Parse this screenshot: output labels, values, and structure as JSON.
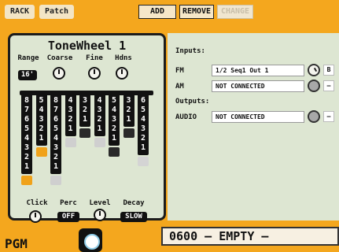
{
  "topbar": {
    "tabs": [
      "RACK",
      "Patch"
    ],
    "buttons": {
      "add": "ADD",
      "remove": "REMOVE",
      "change": "CHANGE"
    }
  },
  "synth": {
    "title": "ToneWheel 1",
    "controls": {
      "range": "Range",
      "coarse": "Coarse",
      "fine": "Fine",
      "hdns": "Hdns",
      "range_value": "16'"
    },
    "drawbars": [
      {
        "nums": [
          "8",
          "7",
          "6",
          "5",
          "4",
          "3",
          "2",
          "1"
        ],
        "color": "#f0a21a"
      },
      {
        "nums": [
          "5",
          "4",
          "3",
          "2",
          "1"
        ],
        "color": "#f0a21a"
      },
      {
        "nums": [
          "8",
          "7",
          "6",
          "5",
          "4",
          "3",
          "2",
          "1"
        ],
        "color": "#cfcfcf"
      },
      {
        "nums": [
          "4",
          "3",
          "2",
          "1"
        ],
        "color": "#cfcfcf"
      },
      {
        "nums": [
          "3",
          "2",
          "1"
        ],
        "color": "#2a2a2a"
      },
      {
        "nums": [
          "4",
          "3",
          "2",
          "1"
        ],
        "color": "#cfcfcf"
      },
      {
        "nums": [
          "5",
          "4",
          "3",
          "2",
          "1"
        ],
        "color": "#2a2a2a"
      },
      {
        "nums": [
          "3",
          "2",
          "1"
        ],
        "color": "#2a2a2a"
      },
      {
        "nums": [
          "6",
          "5",
          "4",
          "3",
          "2",
          "1"
        ],
        "color": "#d4d4d4"
      }
    ],
    "bottom": {
      "click": "Click",
      "perc": "Perc",
      "level": "Level",
      "decay": "Decay",
      "perc_value": "OFF",
      "decay_value": "SLOW"
    }
  },
  "io": {
    "inputs_label": "Inputs:",
    "outputs_label": "Outputs:",
    "rows": [
      {
        "name": "FM",
        "value": "1/2   Seq1 Out 1",
        "tag": "B"
      },
      {
        "name": "AM",
        "value": "NOT CONNECTED",
        "tag": "–"
      },
      {
        "name": "AUDIO",
        "value": "NOT CONNECTED",
        "tag": "–"
      }
    ]
  },
  "footer": {
    "pgm": "PGM",
    "lcd": "0600 – EMPTY –"
  }
}
